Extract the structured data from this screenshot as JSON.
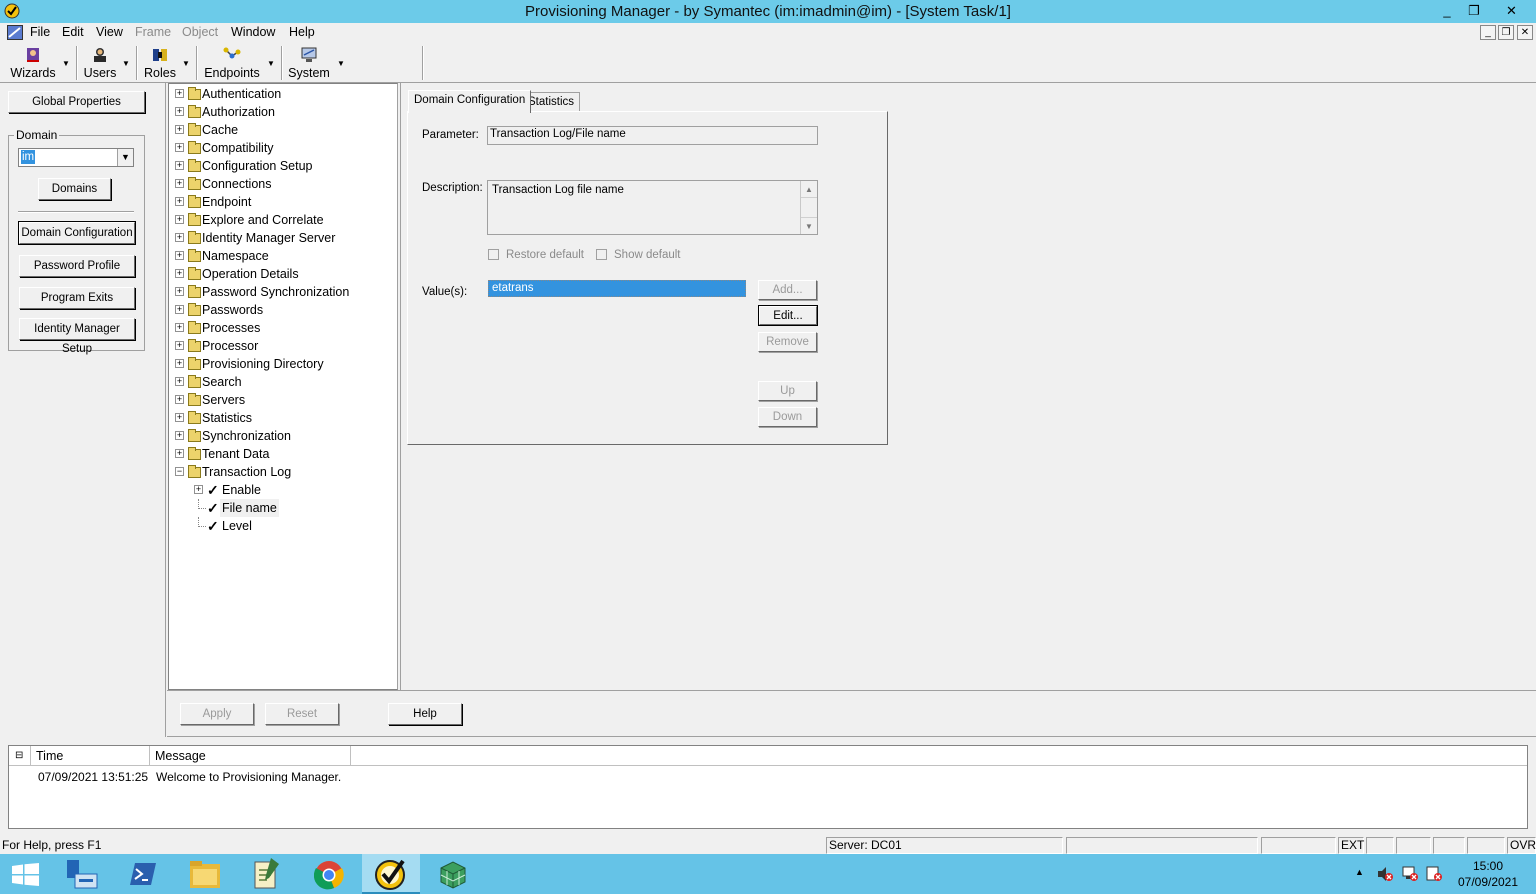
{
  "window": {
    "title": "Provisioning Manager - by Symantec (im:imadmin@im) - [System Task/1]",
    "controls": [
      "_",
      "❐",
      "✕"
    ],
    "mdi_controls": [
      "_",
      "❐",
      "✕"
    ]
  },
  "menu": [
    {
      "label": "File",
      "enabled": true
    },
    {
      "label": "Edit",
      "enabled": true
    },
    {
      "label": "View",
      "enabled": true
    },
    {
      "label": "Frame",
      "enabled": false
    },
    {
      "label": "Object",
      "enabled": false
    },
    {
      "label": "Window",
      "enabled": true
    },
    {
      "label": "Help",
      "enabled": true
    }
  ],
  "toolbar": [
    {
      "label": "Wizards",
      "icon": "wizard-icon"
    },
    {
      "label": "Users",
      "icon": "users-icon"
    },
    {
      "label": "Roles",
      "icon": "roles-icon"
    },
    {
      "label": "Endpoints",
      "icon": "endpoints-icon"
    },
    {
      "label": "System",
      "icon": "system-icon"
    }
  ],
  "left_panel": {
    "global_properties": "Global Properties",
    "domain_group_label": "Domain",
    "domain_value": "im",
    "domains_button": "Domains",
    "buttons": [
      "Domain Configuration",
      "Password Profile",
      "Program Exits",
      "Identity Manager Setup"
    ]
  },
  "tree": {
    "items": [
      "Authentication",
      "Authorization",
      "Cache",
      "Compatibility",
      "Configuration Setup",
      "Connections",
      "Endpoint",
      "Explore and Correlate",
      "Identity Manager Server",
      "Namespace",
      "Operation Details",
      "Password Synchronization",
      "Passwords",
      "Processes",
      "Processor",
      "Provisioning Directory",
      "Search",
      "Servers",
      "Statistics",
      "Synchronization",
      "Tenant Data",
      "Transaction Log"
    ],
    "children": [
      {
        "label": "Enable",
        "expandable": true
      },
      {
        "label": "File name",
        "expandable": false,
        "selected": true
      },
      {
        "label": "Level",
        "expandable": false
      }
    ]
  },
  "tabs": {
    "active": "Domain Configuration",
    "other": "Statistics"
  },
  "form": {
    "parameter_label": "Parameter:",
    "parameter_value": "Transaction Log/File name",
    "description_label": "Description:",
    "description_value": "Transaction Log file name",
    "restore_default": "Restore default",
    "show_default": "Show default",
    "values_label": "Value(s):",
    "value_item": "etatrans",
    "buttons": {
      "add": "Add...",
      "edit": "Edit...",
      "remove": "Remove",
      "up": "Up",
      "down": "Down"
    }
  },
  "bottom_buttons": {
    "apply": "Apply",
    "reset": "Reset",
    "help": "Help"
  },
  "log": {
    "columns": [
      "Time",
      "Message"
    ],
    "rows": [
      {
        "time": "07/09/2021 13:51:25",
        "message": "Welcome to Provisioning Manager."
      }
    ]
  },
  "status": {
    "help_text": "For Help, press F1",
    "server": "Server: DC01",
    "ext": "EXT",
    "ovr": "OVR"
  },
  "taskbar": {
    "apps": [
      "start",
      "server-manager",
      "powershell",
      "file-explorer",
      "notepad",
      "chrome",
      "provisioning-manager",
      "cube-app"
    ],
    "time": "15:00",
    "date": "07/09/2021"
  },
  "colors": {
    "titlebar": "#6ccbe9",
    "taskbar": "#65c3e7",
    "selection": "#3393df"
  }
}
